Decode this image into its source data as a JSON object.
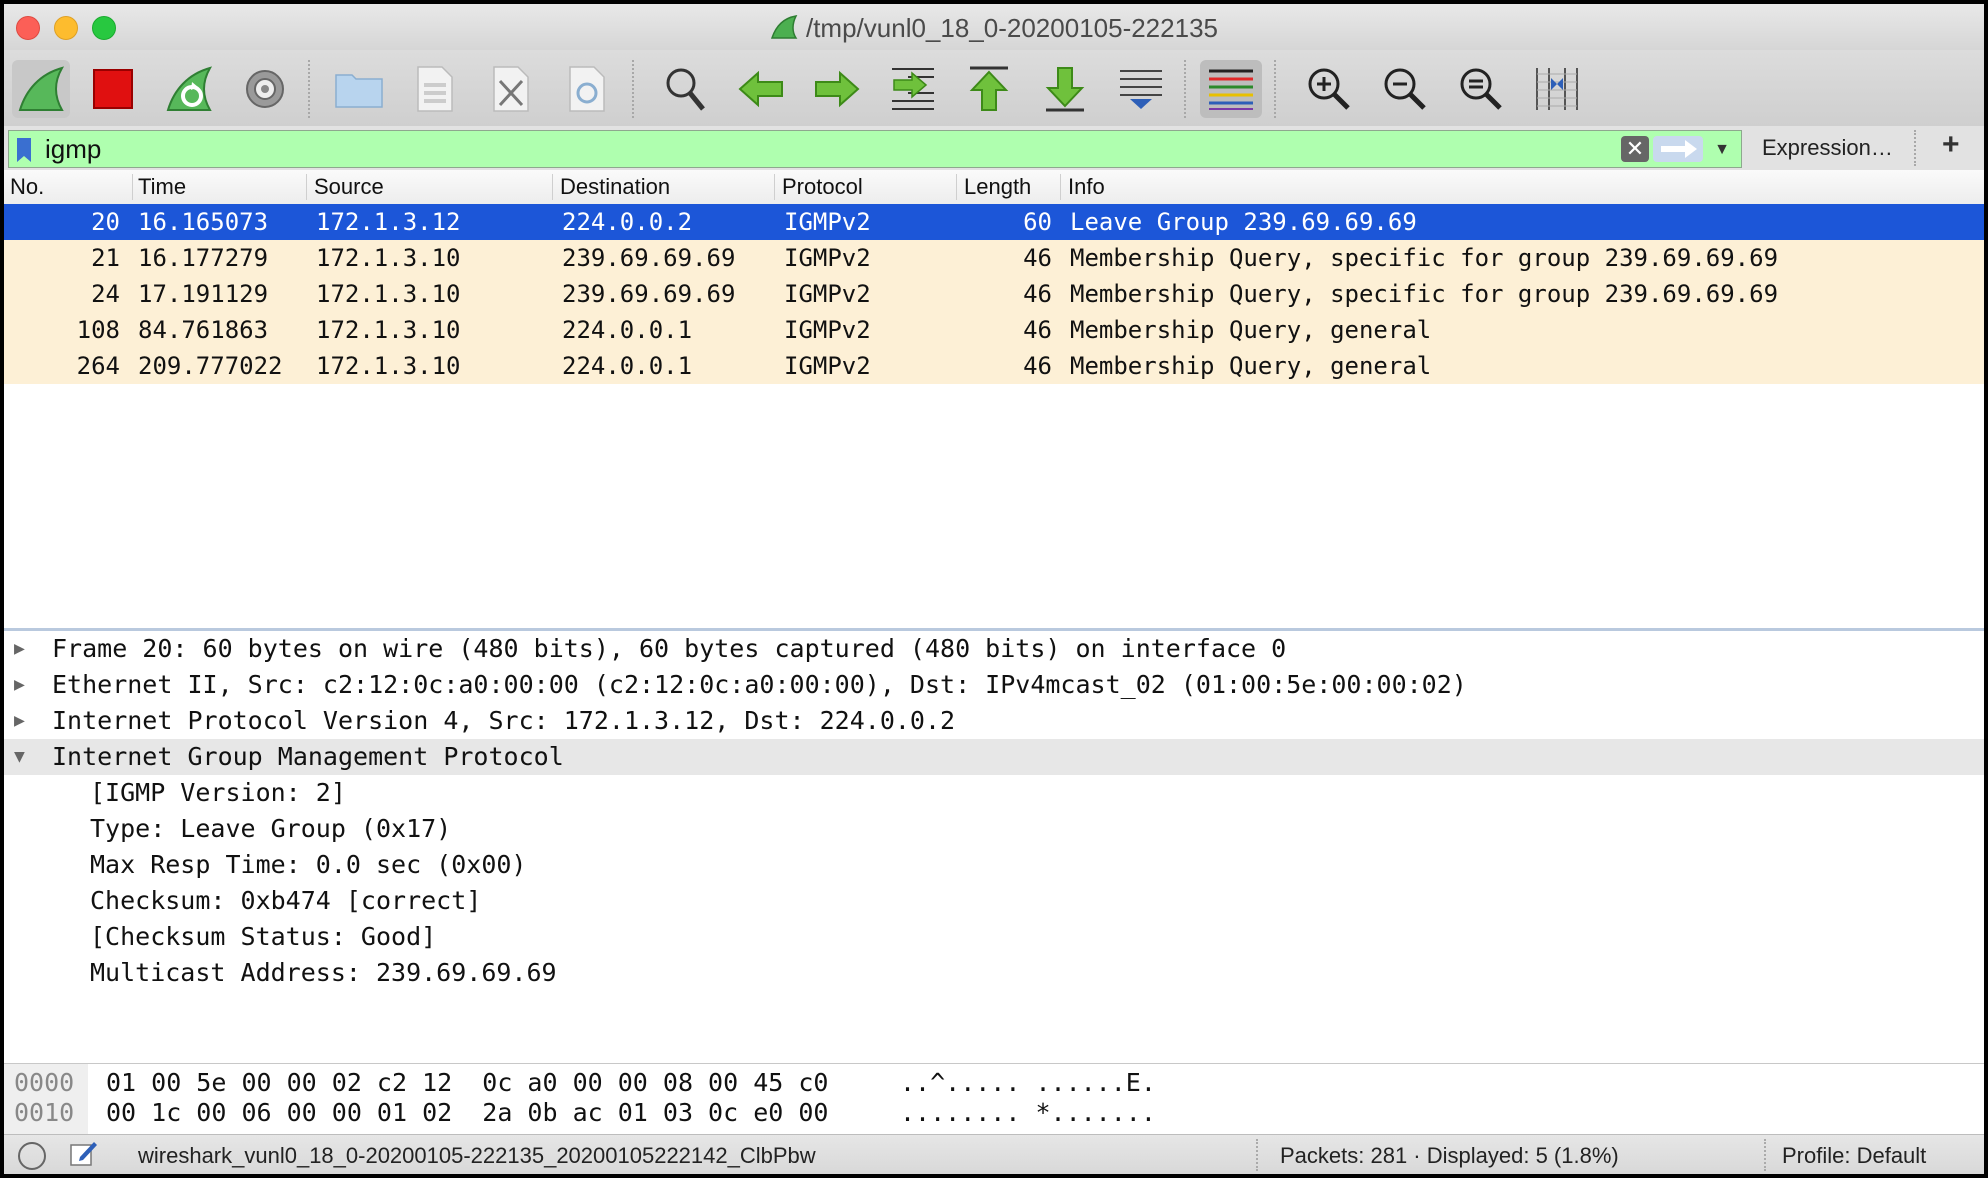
{
  "window": {
    "title": "/tmp/vunl0_18_0-20200105-222135"
  },
  "toolbar": {
    "buttons": [
      "start-capture-icon",
      "stop-capture-icon",
      "restart-capture-icon",
      "capture-options-icon",
      "open-file-icon",
      "save-file-icon",
      "close-file-icon",
      "reload-file-icon",
      "find-packet-icon",
      "go-back-icon",
      "go-forward-icon",
      "go-to-packet-icon",
      "first-packet-icon",
      "last-packet-icon",
      "auto-scroll-icon",
      "colorize-icon",
      "zoom-in-icon",
      "zoom-out-icon",
      "zoom-reset-icon",
      "resize-columns-icon"
    ]
  },
  "filter": {
    "value": "igmp",
    "expression_label": "Expression…",
    "add_label": "+",
    "clear_label": "✕"
  },
  "packet_list": {
    "columns": [
      "No.",
      "Time",
      "Source",
      "Destination",
      "Protocol",
      "Length",
      "Info"
    ],
    "rows": [
      {
        "no": "20",
        "time": "16.165073",
        "source": "172.1.3.12",
        "destination": "224.0.0.2",
        "protocol": "IGMPv2",
        "length": "60",
        "info": "Leave Group 239.69.69.69"
      },
      {
        "no": "21",
        "time": "16.177279",
        "source": "172.1.3.10",
        "destination": "239.69.69.69",
        "protocol": "IGMPv2",
        "length": "46",
        "info": "Membership Query, specific for group 239.69.69.69"
      },
      {
        "no": "24",
        "time": "17.191129",
        "source": "172.1.3.10",
        "destination": "239.69.69.69",
        "protocol": "IGMPv2",
        "length": "46",
        "info": "Membership Query, specific for group 239.69.69.69"
      },
      {
        "no": "108",
        "time": "84.761863",
        "source": "172.1.3.10",
        "destination": "224.0.0.1",
        "protocol": "IGMPv2",
        "length": "46",
        "info": "Membership Query, general"
      },
      {
        "no": "264",
        "time": "209.777022",
        "source": "172.1.3.10",
        "destination": "224.0.0.1",
        "protocol": "IGMPv2",
        "length": "46",
        "info": "Membership Query, general"
      }
    ],
    "selected_index": 0
  },
  "details": {
    "tree": [
      {
        "text": "Frame 20: 60 bytes on wire (480 bits), 60 bytes captured (480 bits) on interface 0",
        "expanded": false
      },
      {
        "text": "Ethernet II, Src: c2:12:0c:a0:00:00 (c2:12:0c:a0:00:00), Dst: IPv4mcast_02 (01:00:5e:00:00:02)",
        "expanded": false
      },
      {
        "text": "Internet Protocol Version 4, Src: 172.1.3.12, Dst: 224.0.0.2",
        "expanded": false
      },
      {
        "text": "Internet Group Management Protocol",
        "expanded": true
      }
    ],
    "igmp_fields": [
      "[IGMP Version: 2]",
      "Type: Leave Group (0x17)",
      "Max Resp Time: 0.0 sec (0x00)",
      "Checksum: 0xb474 [correct]",
      "[Checksum Status: Good]",
      "Multicast Address: 239.69.69.69"
    ]
  },
  "hex": {
    "lines": [
      {
        "offset": "0000",
        "bytes": "01 00 5e 00 00 02 c2 12  0c a0 00 00 08 00 45 c0",
        "ascii": "..^..... ......E."
      },
      {
        "offset": "0010",
        "bytes": "00 1c 00 06 00 00 01 02  2a 0b ac 01 03 0c e0 00",
        "ascii": "........ *......."
      }
    ]
  },
  "status": {
    "file": "wireshark_vunl0_18_0-20200105-222135_20200105222142_ClbPbw",
    "packets": "Packets: 281 · Displayed: 5 (1.8%)",
    "profile": "Profile: Default"
  },
  "colors": {
    "filter_valid": "#afffaf",
    "selected_row": "#1c56d8",
    "igmp_row": "#fdf0d6"
  }
}
